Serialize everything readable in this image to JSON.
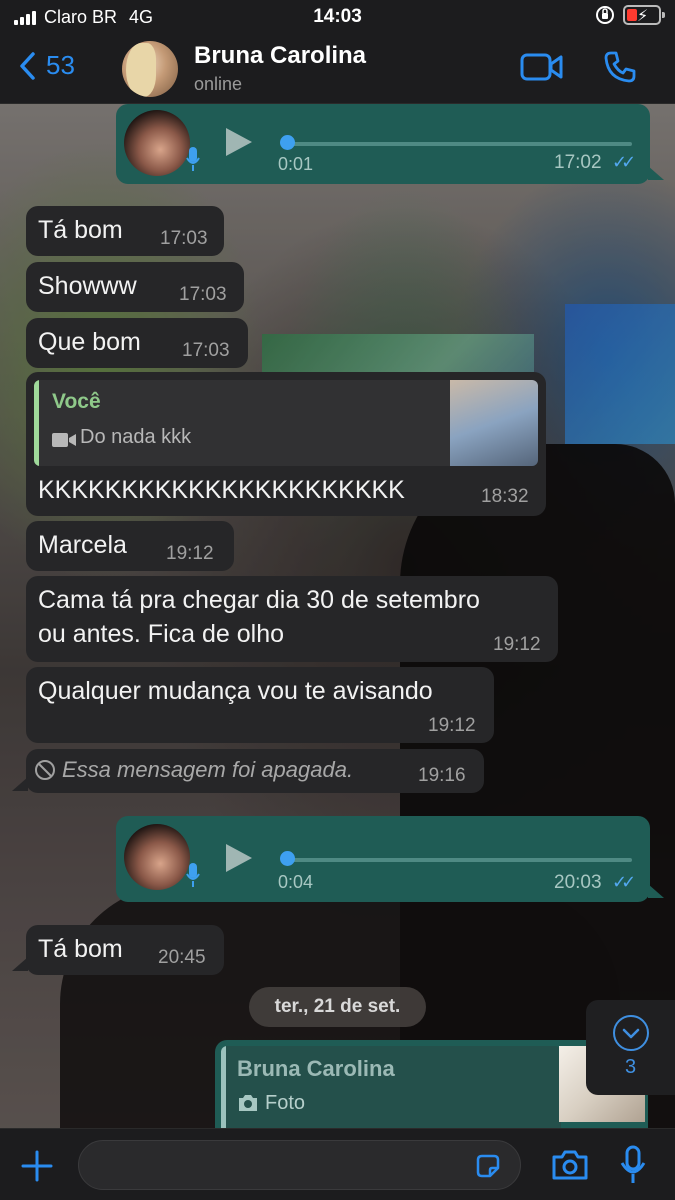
{
  "status_bar": {
    "carrier": "Claro BR",
    "network": "4G",
    "time": "14:03"
  },
  "header": {
    "back_count": "53",
    "contact_name": "Bruna Carolina",
    "contact_status": "online"
  },
  "messages": [
    {
      "type": "voice",
      "direction": "out",
      "duration": "0:01",
      "time": "17:02",
      "ticks": "✓✓"
    },
    {
      "type": "text",
      "direction": "in",
      "text": "Tá bom",
      "time": "17:03"
    },
    {
      "type": "text",
      "direction": "in",
      "text": "Showww",
      "time": "17:03"
    },
    {
      "type": "text",
      "direction": "in",
      "text": "Que bom",
      "time": "17:03"
    },
    {
      "type": "reply",
      "direction": "in",
      "quote_name": "Você",
      "quote_text": "Do nada kkk",
      "text": "KKKKKKKKKKKKKKKKKKKKKK",
      "time": "18:32"
    },
    {
      "type": "text",
      "direction": "in",
      "text": "Marcela",
      "time": "19:12"
    },
    {
      "type": "text",
      "direction": "in",
      "line1": "Cama tá pra chegar dia 30 de setembro",
      "line2": "ou antes. Fica de olho",
      "time": "19:12"
    },
    {
      "type": "text",
      "direction": "in",
      "text": "Qualquer mudança vou te avisando",
      "time": "19:12"
    },
    {
      "type": "deleted",
      "direction": "in",
      "text": "Essa mensagem foi apagada.",
      "time": "19:16"
    },
    {
      "type": "voice",
      "direction": "out",
      "duration": "0:04",
      "time": "20:03",
      "ticks": "✓✓"
    },
    {
      "type": "text",
      "direction": "in",
      "text": "Tá bom",
      "time": "20:45"
    },
    {
      "type": "reply_preview",
      "direction": "out",
      "quote_name": "Bruna Carolina",
      "quote_text": "Foto"
    }
  ],
  "date_separator": "ter., 21 de set.",
  "scroll_down": {
    "unread_count": "3"
  },
  "colors": {
    "accent": "#2a8cf0",
    "incoming_bubble": "#262628",
    "outgoing_bubble": "#1f5c55"
  },
  "icons": [
    "back-chevron-icon",
    "video-call-icon",
    "phone-icon",
    "mic-icon",
    "play-icon",
    "video-camera-icon",
    "camera-icon",
    "sticker-icon",
    "plus-icon",
    "ban-icon",
    "chevron-down-icon"
  ]
}
